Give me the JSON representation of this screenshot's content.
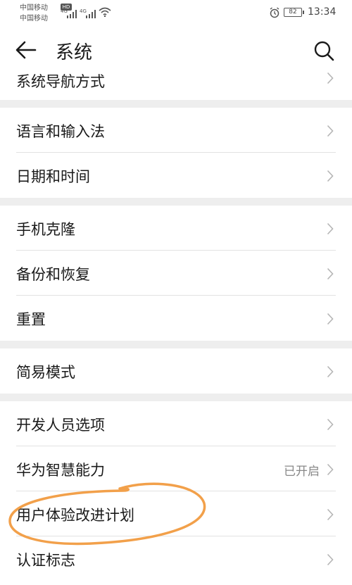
{
  "status_bar": {
    "carrier_1": "中国移动",
    "carrier_2": "中国移动",
    "hd_badge": "HD",
    "network_1": "4G",
    "network_2": "4G",
    "battery_level": "82",
    "time": "13:34"
  },
  "app_bar": {
    "title": "系统"
  },
  "settings": {
    "nav_mode": "系统导航方式",
    "language_input": "语言和输入法",
    "date_time": "日期和时间",
    "phone_clone": "手机克隆",
    "backup_restore": "备份和恢复",
    "reset": "重置",
    "simple_mode": "简易模式",
    "developer_options": "开发人员选项",
    "huawei_ai": "华为智慧能力",
    "huawei_ai_status": "已开启",
    "user_experience": "用户体验改进计划",
    "certification": "认证标志"
  },
  "colors": {
    "annotation_circle": "#f2a04a",
    "section_gap": "#eeeeee"
  }
}
